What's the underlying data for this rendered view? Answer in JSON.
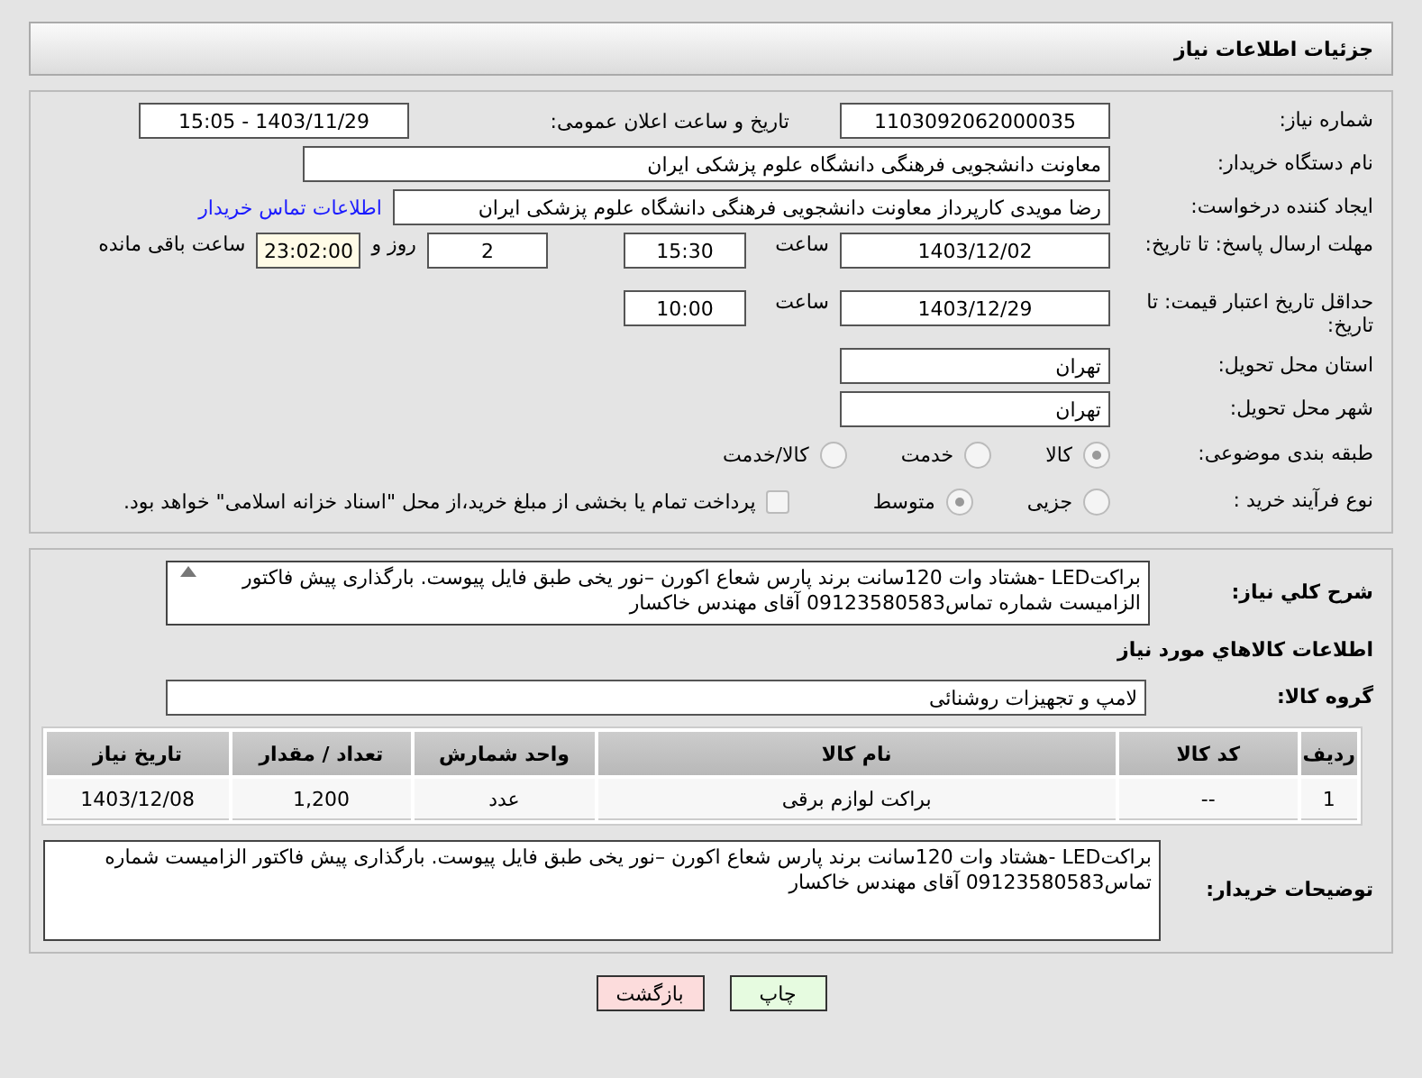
{
  "header": {
    "title": "جزئیات اطلاعات نیاز"
  },
  "need_number": {
    "label": "شماره نیاز:",
    "value": "1103092062000035"
  },
  "announce": {
    "label": "تاریخ و ساعت اعلان عمومی:",
    "value": "1403/11/29 - 15:05"
  },
  "buyer_org": {
    "label": "نام دستگاه خریدار:",
    "value": "معاونت دانشجویی  فرهنگی دانشگاه علوم پزشکی ایران"
  },
  "requester": {
    "label": "ایجاد کننده درخواست:",
    "value": "رضا  مویدی  کارپرداز معاونت دانشجویی  فرهنگی دانشگاه علوم پزشکی ایران",
    "link": "اطلاعات تماس خریدار"
  },
  "reply_deadline": {
    "label": "مهلت ارسال پاسخ: تا تاریخ:",
    "date": "1403/12/02",
    "time_label": "ساعت",
    "time": "15:30",
    "days": "2",
    "days_label": "روز و",
    "remaining": "23:02:00",
    "remaining_label": "ساعت باقی مانده"
  },
  "price_validity": {
    "label": "حداقل تاریخ اعتبار قیمت: تا تاریخ:",
    "date": "1403/12/29",
    "time_label": "ساعت",
    "time": "10:00"
  },
  "province": {
    "label": "استان محل تحویل:",
    "value": "تهران"
  },
  "city": {
    "label": "شهر محل تحویل:",
    "value": "تهران"
  },
  "category": {
    "label": "طبقه بندی موضوعی:",
    "options": [
      {
        "label": "کالا",
        "selected": true
      },
      {
        "label": "خدمت",
        "selected": false
      },
      {
        "label": "کالا/خدمت",
        "selected": false
      }
    ]
  },
  "process": {
    "label": "نوع فرآیند خرید :",
    "options": [
      {
        "label": "جزیی",
        "selected": false
      },
      {
        "label": "متوسط",
        "selected": true
      }
    ],
    "payment": {
      "label": "پرداخت تمام یا بخشی از مبلغ خرید،از محل \"اسناد خزانه اسلامی\" خواهد بود.",
      "checked": false
    }
  },
  "description": {
    "label": "شرح کلي نیاز:",
    "value": "براکتLED  -هشتاد وات  120سانت برند پارس شعاع اکورن –نور یخی طبق فایل پیوست. بارگذاری پیش فاکتور الزامیست شماره تماس09123580583 آقای مهندس خاکسار"
  },
  "goods_heading": "اطلاعات کالاهاي مورد نیاز",
  "goods_group": {
    "label": "گروه کالا:",
    "value": "لامپ و تجهیزات روشنائی"
  },
  "table": {
    "columns": [
      "ردیف",
      "کد کالا",
      "نام کالا",
      "واحد شمارش",
      "تعداد / مقدار",
      "تاریخ نیاز"
    ],
    "rows": [
      [
        "1",
        "--",
        "براکت لوازم برقی",
        "عدد",
        "1,200",
        "1403/12/08"
      ]
    ]
  },
  "buyer_notes": {
    "label": "توضیحات خریدار:",
    "value": "براکتLED  -هشتاد وات  120سانت برند پارس شعاع اکورن –نور یخی طبق فایل پیوست. بارگذاری پیش فاکتور الزامیست شماره تماس09123580583 آقای مهندس خاکسار"
  },
  "buttons": [
    {
      "label": "چاپ",
      "kind": "print"
    },
    {
      "label": "بازگشت",
      "kind": "back"
    }
  ]
}
